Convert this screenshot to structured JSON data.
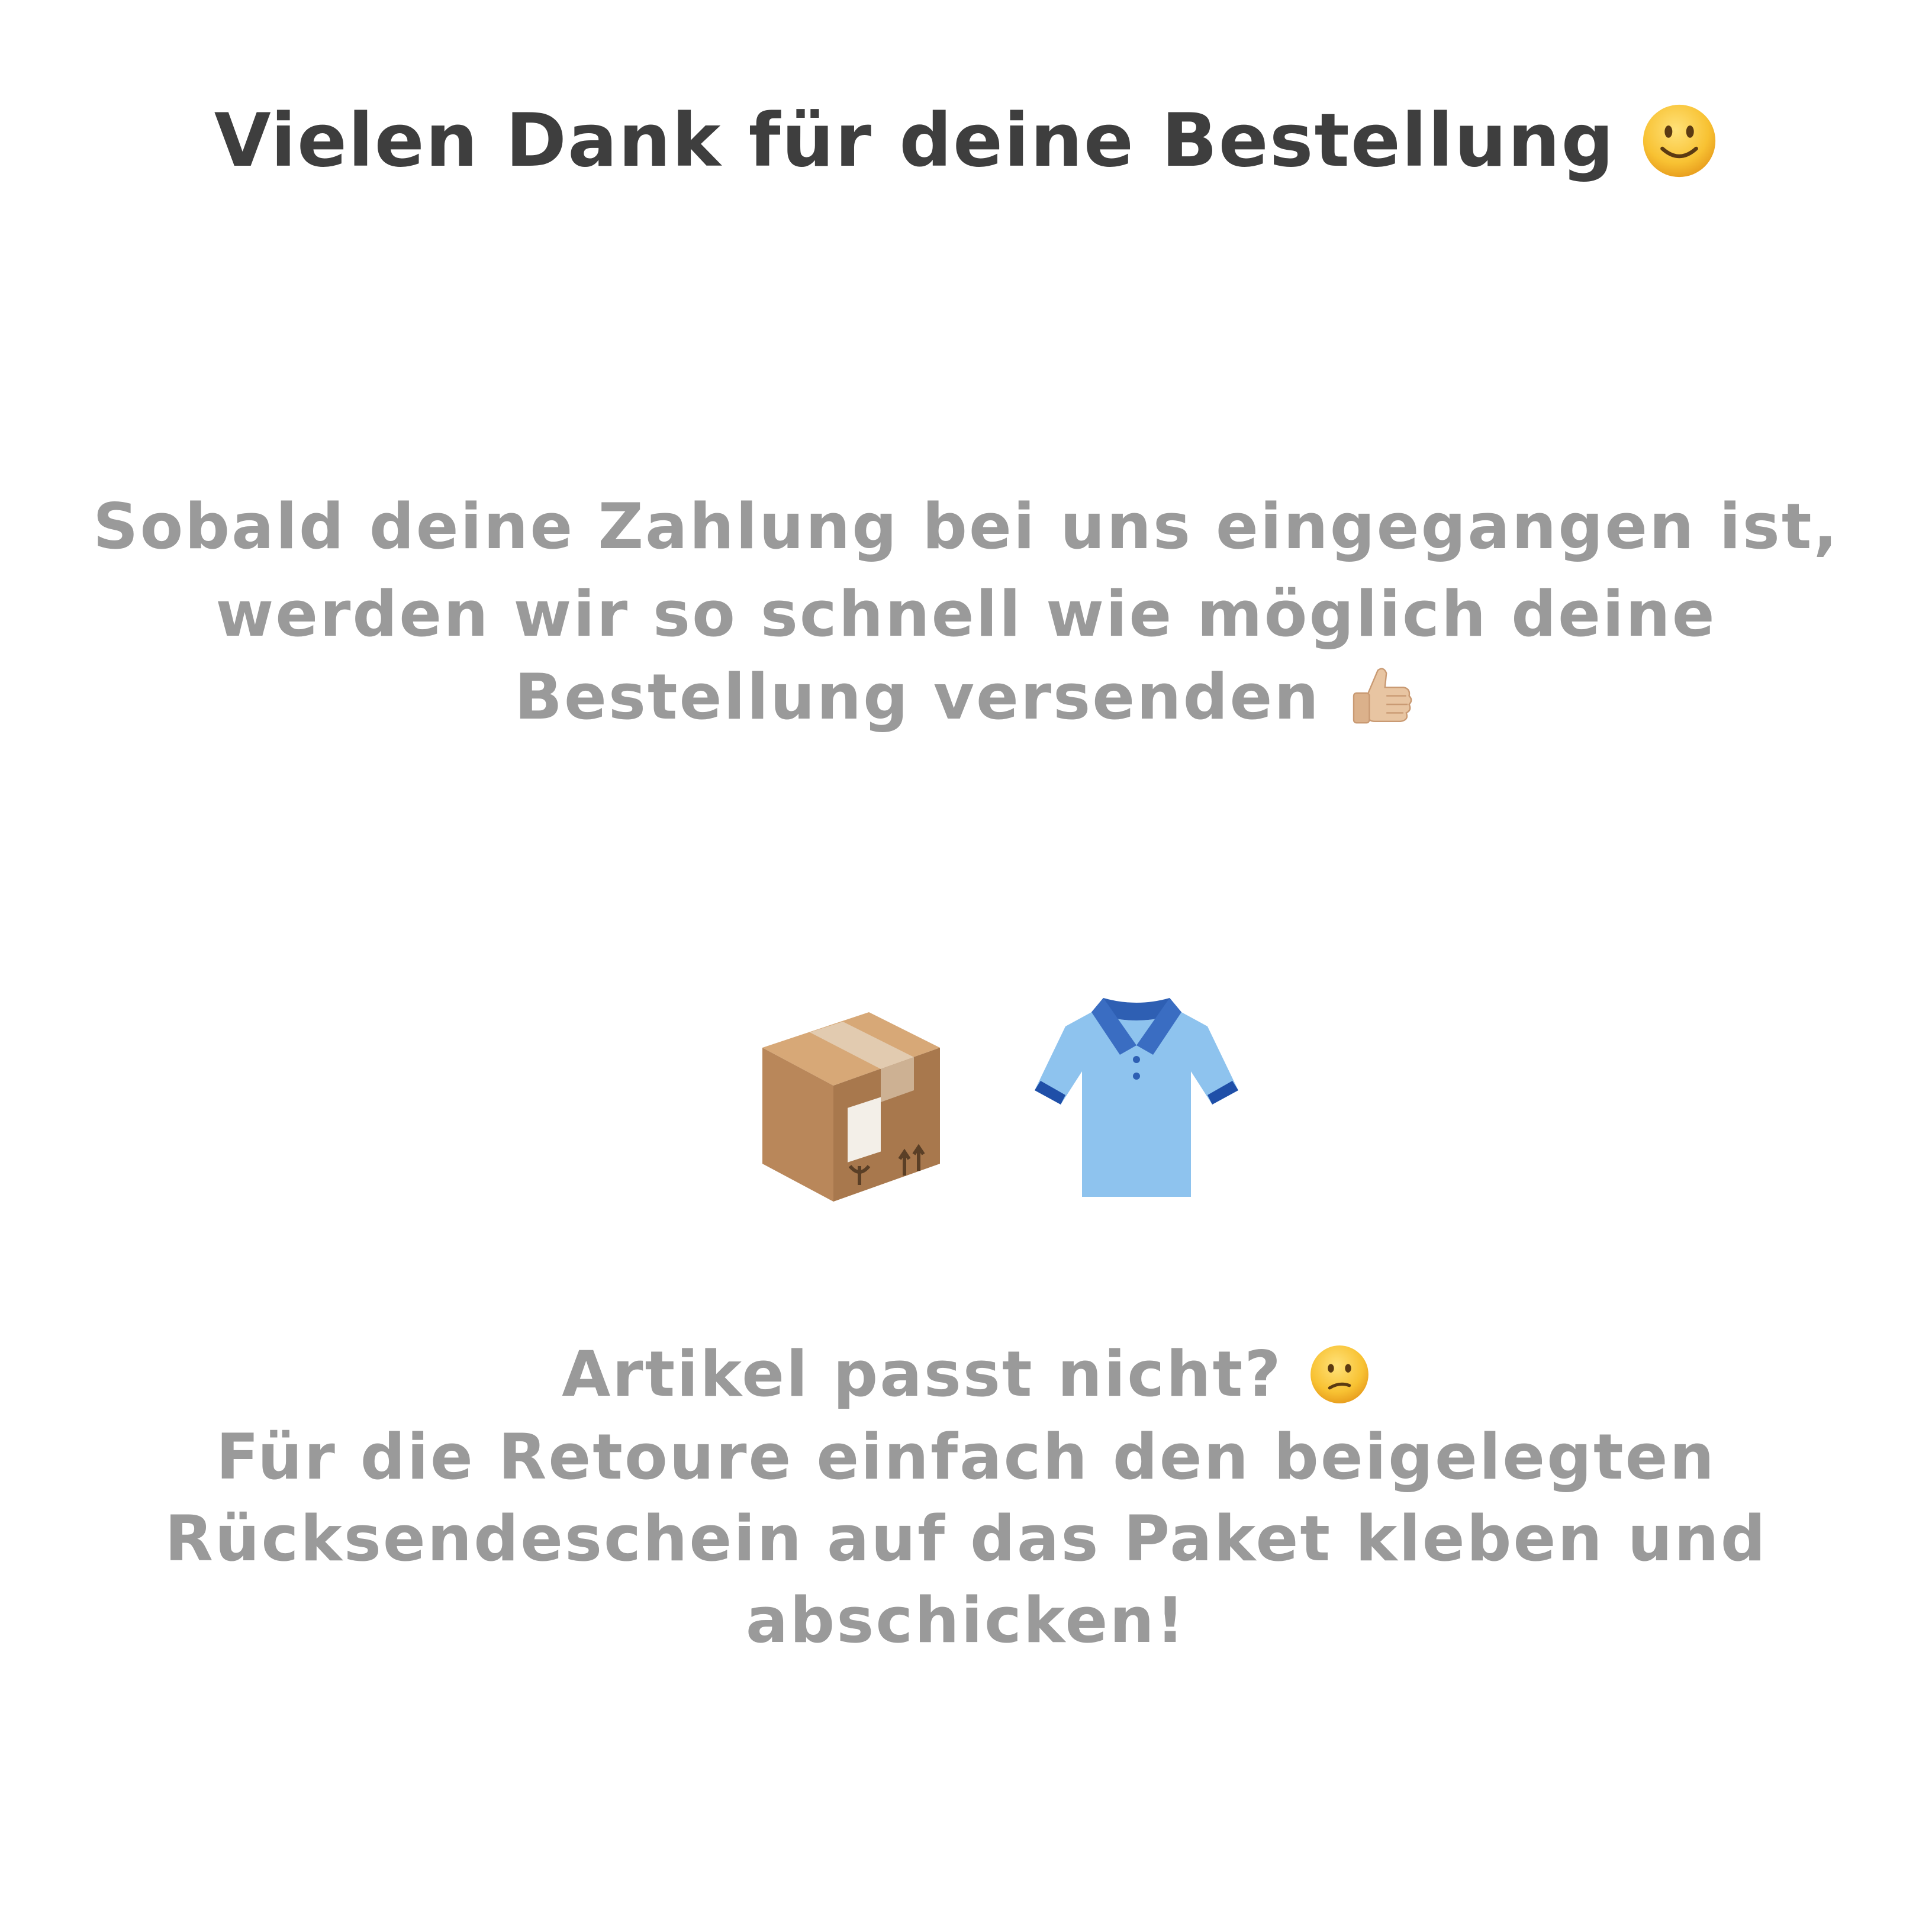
{
  "heading": {
    "text": "Vielen Dank für deine Bestellung",
    "emoji_icon": "slightly-smiling-face-icon"
  },
  "payment_note": {
    "lines": [
      "Sobald deine Zahlung bei uns eingegangen ist,",
      "werden wir so schnell wie möglich deine",
      "Bestellung versenden"
    ],
    "emoji_icon": "thumbs-up-icon"
  },
  "illustration": {
    "icons": [
      "package-icon",
      "polo-shirt-icon"
    ]
  },
  "return_note": {
    "question": "Artikel passt nicht?",
    "question_emoji_icon": "confused-face-icon",
    "lines": [
      "Für die Retoure einfach den beigelegten",
      "Rücksendeschein auf das Paket kleben und",
      "abschicken!"
    ]
  },
  "colors": {
    "background": "#ffffff",
    "heading_text": "#3e3e3e",
    "body_text": "#9a9a9a",
    "package_brown": "#b9875a",
    "shirt_blue": "#8ec3ee",
    "collar_blue": "#2e5fb3",
    "emoji_yellow": "#f8c233"
  }
}
